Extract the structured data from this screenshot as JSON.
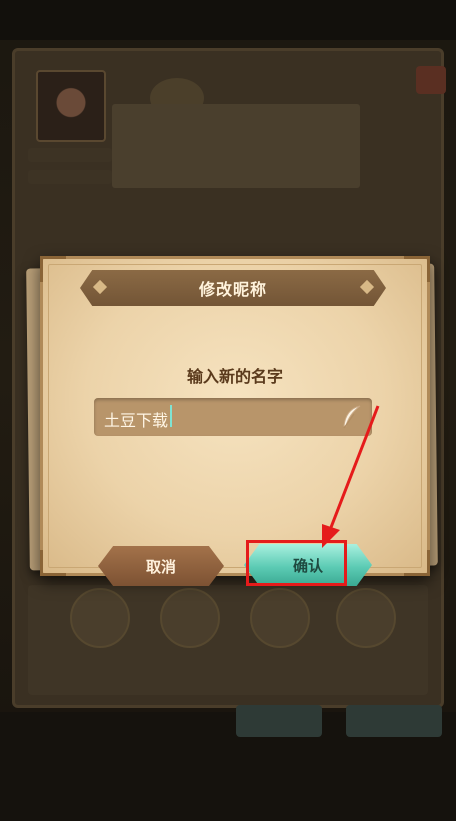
{
  "dialog": {
    "title": "修改昵称",
    "prompt": "输入新的名字",
    "name_input": {
      "value": "土豆下载"
    },
    "cancel_label": "取消",
    "confirm_label": "确认"
  },
  "annotation": {
    "color": "#e51b1b"
  },
  "icons": {
    "feather": "feather-icon"
  }
}
